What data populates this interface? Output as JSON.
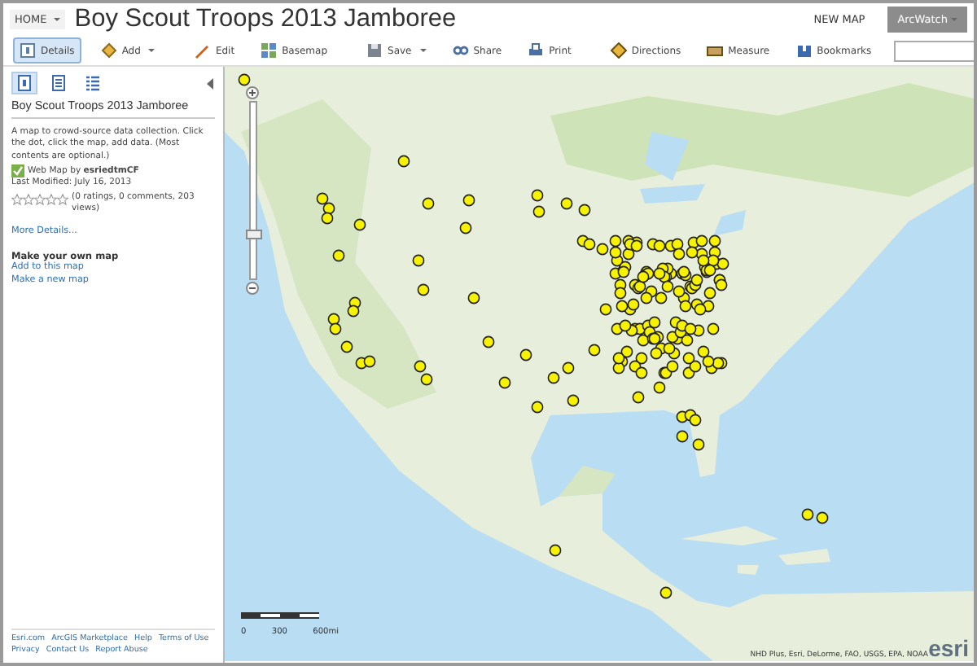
{
  "header": {
    "home": "HOME",
    "title": "Boy Scout Troops 2013 Jamboree",
    "new_map": "NEW MAP",
    "account": "ArcWatch"
  },
  "toolbar": {
    "groups": [
      [
        {
          "label": "Details",
          "kind": "details",
          "dropdown": false,
          "selected": true
        },
        {
          "label": "Add",
          "kind": "add",
          "dropdown": true,
          "selected": false
        }
      ],
      [
        {
          "label": "Edit",
          "kind": "edit",
          "dropdown": false,
          "selected": false
        },
        {
          "label": "Basemap",
          "kind": "basemap",
          "dropdown": false,
          "selected": false
        }
      ],
      [
        {
          "label": "Save",
          "kind": "save",
          "dropdown": true,
          "selected": false
        },
        {
          "label": "Share",
          "kind": "share",
          "dropdown": false,
          "selected": false
        },
        {
          "label": "Print",
          "kind": "print",
          "dropdown": false,
          "selected": false
        }
      ],
      [
        {
          "label": "Directions",
          "kind": "directions",
          "dropdown": false,
          "selected": false
        },
        {
          "label": "Measure",
          "kind": "measure",
          "dropdown": false,
          "selected": false
        },
        {
          "label": "Bookmarks",
          "kind": "bookmarks",
          "dropdown": false,
          "selected": false
        }
      ]
    ]
  },
  "sidebar": {
    "tabs": [
      {
        "kind": "about",
        "selected": true
      },
      {
        "kind": "content",
        "selected": false
      },
      {
        "kind": "legend",
        "selected": false
      }
    ],
    "title": "Boy Scout Troops 2013 Jamboree",
    "description": "A map to crowd-source data collection. Click the dot, click the map, add data. (Most contents are optional.)",
    "owner": "Web Map by **esriedtmCF**",
    "modified": "Last Modified: July 16, 2013",
    "stars": 0,
    "stats": "(0 ratings, 0 comments, 203 views)",
    "more": "More Details...",
    "make_heading": "Make your own map",
    "links": [
      "Add to this map",
      "Make a new map"
    ],
    "footer": [
      "Esri.com",
      "ArcGIS Marketplace",
      "Help",
      "Terms of Use",
      "Privacy",
      "Contact Us",
      "Report Abuse"
    ]
  },
  "map": {
    "zoom": {
      "level": 0.25
    },
    "scale": [
      "0",
      "300",
      "600mi"
    ],
    "attribution": "NHD Plus, Esri, DeLorme, FAO, USGS, EPA, NOAA",
    "logo": "esri"
  }
}
